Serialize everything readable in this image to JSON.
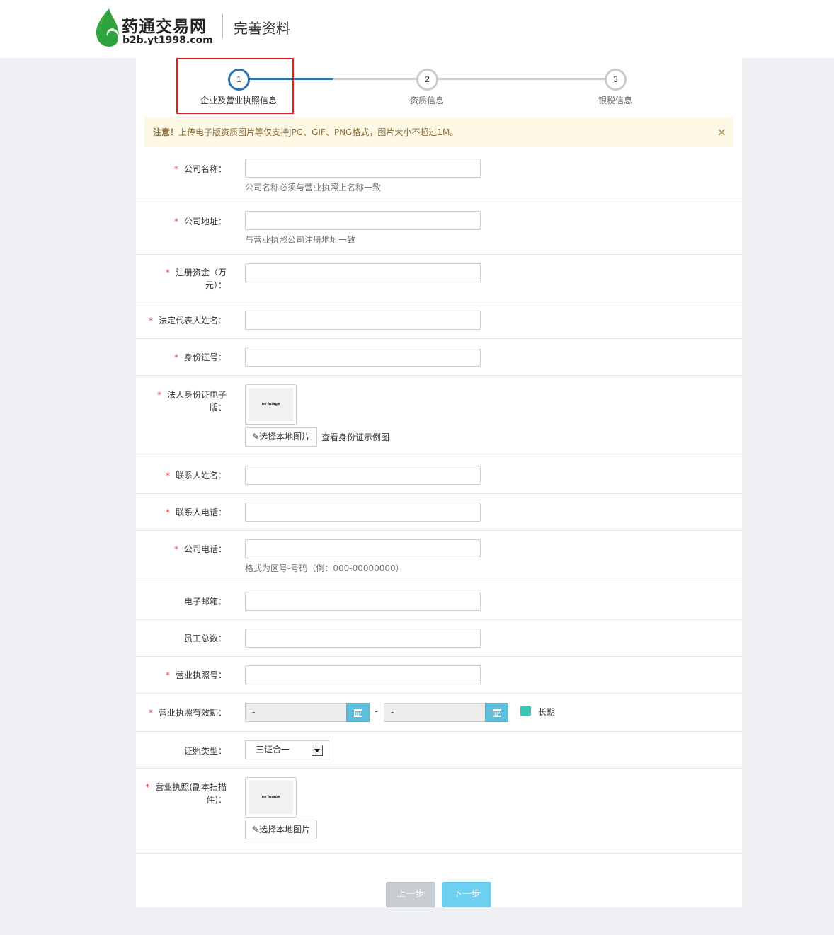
{
  "header": {
    "logo_title": "药通交易网",
    "logo_url": "b2b.yt1998.com",
    "page_title": "完善资料"
  },
  "steps": [
    {
      "number": "1",
      "label": "企业及营业执照信息",
      "active": true
    },
    {
      "number": "2",
      "label": "资质信息",
      "active": false
    },
    {
      "number": "3",
      "label": "银税信息",
      "active": false
    }
  ],
  "alert": {
    "strong": "注意！",
    "text": "上传电子版资质图片等仅支持JPG、GIF、PNG格式，图片大小不超过1M。",
    "close": "×"
  },
  "form": {
    "company_name": {
      "label": "公司名称：",
      "value": "",
      "help": "公司名称必须与营业执照上名称一致"
    },
    "company_address": {
      "label": "公司地址：",
      "value": "",
      "help": "与营业执照公司注册地址一致"
    },
    "registered_capital": {
      "label_line1": "注册资金（万",
      "label_line2": "元）：",
      "value": ""
    },
    "legal_rep_name": {
      "label": "法定代表人姓名：",
      "value": ""
    },
    "id_number": {
      "label": "身份证号：",
      "value": ""
    },
    "legal_id_scan": {
      "label_line1": "法人身份证电子",
      "label_line2": "版：",
      "thumb_text": "no image",
      "upload_button": "选择本地图片",
      "sample_link": "查看身份证示例图"
    },
    "contact_name": {
      "label": "联系人姓名：",
      "value": ""
    },
    "contact_phone": {
      "label": "联系人电话：",
      "value": ""
    },
    "company_phone": {
      "label": "公司电话：",
      "value": "",
      "help": "格式为区号-号码（例：000-00000000）"
    },
    "email": {
      "label": "电子邮箱：",
      "value": ""
    },
    "employee_count": {
      "label": "员工总数：",
      "value": ""
    },
    "license_number": {
      "label": "营业执照号：",
      "value": ""
    },
    "license_validity": {
      "label": "营业执照有效期：",
      "start": "-",
      "end": "-",
      "separator": "-",
      "long_term_label": "长期",
      "long_term_checked": true
    },
    "license_type": {
      "label": "证照类型：",
      "selected": "三证合一"
    },
    "license_scan": {
      "label_line1": "营业执照(副本扫描",
      "label_line2": "件)：",
      "thumb_text": "no image",
      "upload_button": "选择本地图片"
    }
  },
  "required_mark": "*",
  "buttons": {
    "prev": "上一步",
    "next": "下一步"
  },
  "colors": {
    "primary": "#2f72b2",
    "required": "#e4393c",
    "date_button": "#5bc0de",
    "checkbox": "#3cc4b4",
    "next_button": "#6dd0f1",
    "highlight": "#e52020"
  }
}
